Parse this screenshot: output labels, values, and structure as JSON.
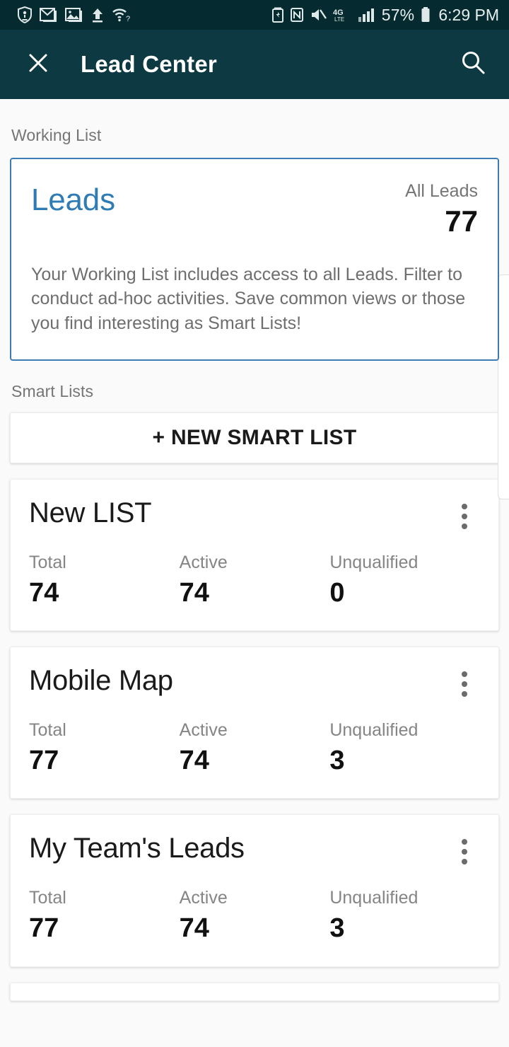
{
  "status_bar": {
    "left_icons": [
      "shield-icon",
      "gmail-icon",
      "photo-icon",
      "upload-icon",
      "wifi-question-icon"
    ],
    "right_icons": [
      "battery-saver-icon",
      "nfc-icon",
      "volume-off-icon"
    ],
    "network_type": "4G",
    "network_sub": "LTE",
    "signal_icon": "signal-bars-icon",
    "battery_percent": "57%",
    "battery_icon": "battery-icon",
    "clock": "6:29 PM"
  },
  "app_bar": {
    "close_icon": "close-icon",
    "title": "Lead Center",
    "search_icon": "search-icon",
    "background": "#0d3a42"
  },
  "sections": {
    "working_list_label": "Working List",
    "smart_lists_label": "Smart Lists"
  },
  "working_list": {
    "title": "Leads",
    "title_color": "#2f7cb5",
    "border_color": "#3d7cb3",
    "metric_label": "All Leads",
    "metric_value": "77",
    "description": "Your Working List includes access to all Leads. Filter to conduct ad-hoc activities. Save common views or those you find interesting as Smart Lists!"
  },
  "smart_lists": {
    "new_button_label": "+ NEW SMART LIST",
    "stat_labels": {
      "total": "Total",
      "active": "Active",
      "unqualified": "Unqualified"
    },
    "items": [
      {
        "name": "New LIST",
        "menu_icon": "kebab-menu-icon",
        "total": "74",
        "active": "74",
        "unqualified": "0"
      },
      {
        "name": "Mobile Map",
        "menu_icon": "kebab-menu-icon",
        "total": "77",
        "active": "74",
        "unqualified": "3"
      },
      {
        "name": "My Team's Leads",
        "menu_icon": "kebab-menu-icon",
        "total": "77",
        "active": "74",
        "unqualified": "3"
      }
    ]
  }
}
